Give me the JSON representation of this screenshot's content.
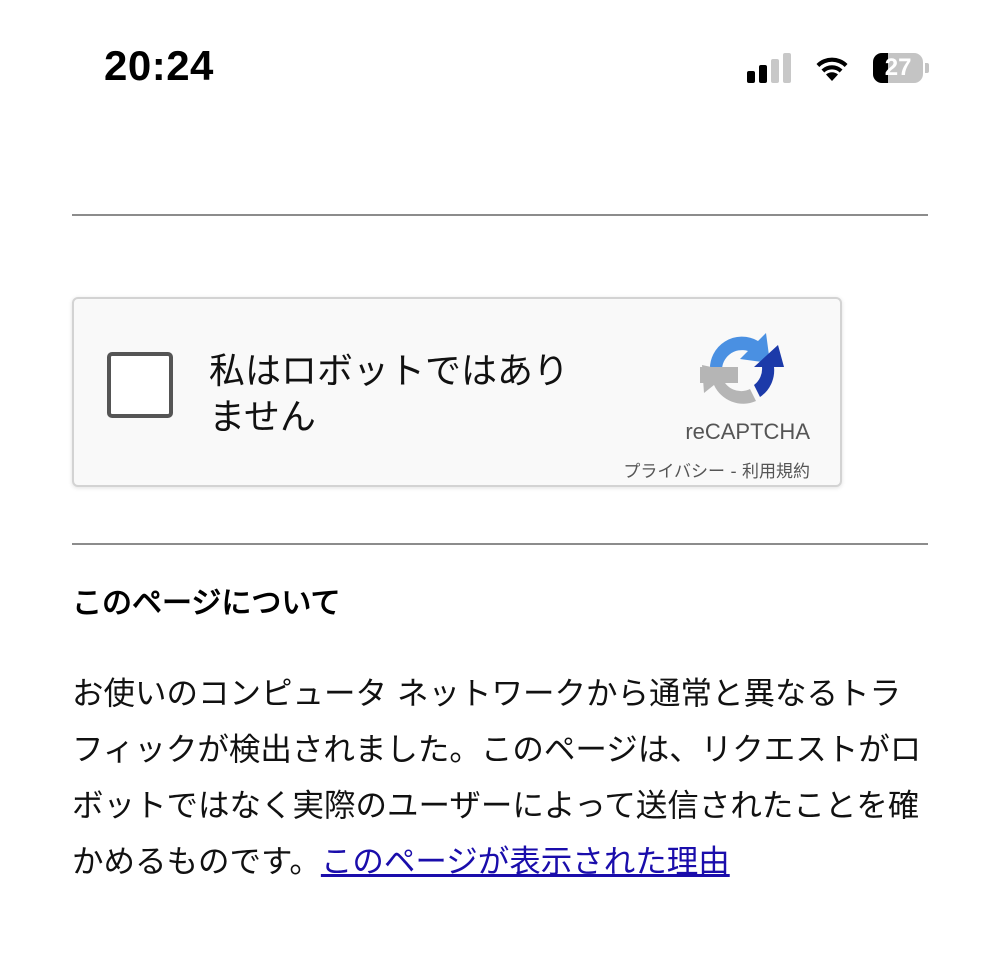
{
  "status_bar": {
    "time": "20:24",
    "battery_level": "27",
    "icons": [
      "cellular-signal-icon",
      "wifi-icon",
      "battery-icon"
    ]
  },
  "recaptcha": {
    "checkbox_label": "私はロボットではありません",
    "checked": false,
    "brand": "reCAPTCHA",
    "privacy_link": "プライバシー",
    "separator": " - ",
    "terms_link": "利用規約",
    "logo_icon": "recaptcha-logo-icon",
    "colors": {
      "logo_blue": "#4a90e2",
      "logo_dark_blue": "#1c3aa9",
      "logo_grey": "#b5b5b5"
    }
  },
  "about": {
    "heading": "このページについて",
    "body": "お使いのコンピュータ ネットワークから通常と異なるトラフィックが検出されました。このページは、リクエストがロボットではなく実際のユーザーによって送信されたことを確かめるものです。",
    "link_text": "このページが表示された理由",
    "link_color": "#1a0dab"
  }
}
